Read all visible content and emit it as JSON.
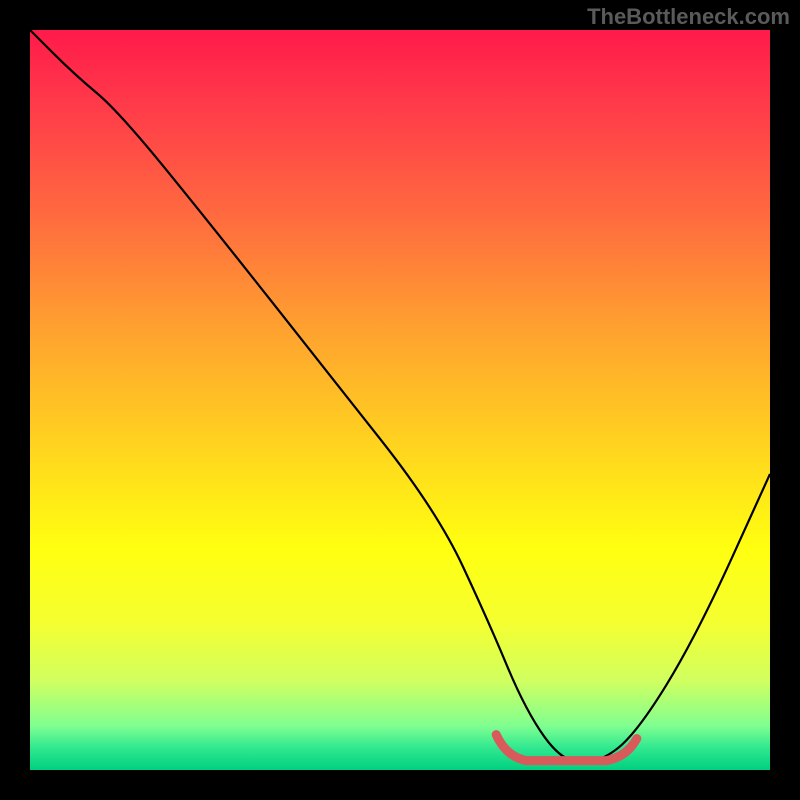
{
  "watermark": "TheBottleneck.com",
  "chart_data": {
    "type": "line",
    "title": "",
    "xlabel": "",
    "ylabel": "",
    "xlim": [
      0,
      100
    ],
    "ylim": [
      0,
      100
    ],
    "grid": false,
    "legend": false,
    "series": [
      {
        "name": "bottleneck-curve",
        "x": [
          0,
          6,
          12,
          25,
          40,
          55,
          62,
          67,
          72,
          77,
          82,
          90,
          100
        ],
        "y": [
          100,
          94,
          89,
          73,
          54,
          35,
          20,
          8,
          1,
          1,
          5,
          18,
          40
        ]
      }
    ],
    "highlight_region": {
      "name": "optimal-range",
      "x": [
        63,
        82
      ],
      "y_approx": 1,
      "color": "#d85a5a"
    },
    "gradient_stops": [
      {
        "pos": 0,
        "color": "#ff1a4a"
      },
      {
        "pos": 25,
        "color": "#ff6a3f"
      },
      {
        "pos": 55,
        "color": "#ffd020"
      },
      {
        "pos": 80,
        "color": "#f5ff30"
      },
      {
        "pos": 100,
        "color": "#00d080"
      }
    ]
  }
}
